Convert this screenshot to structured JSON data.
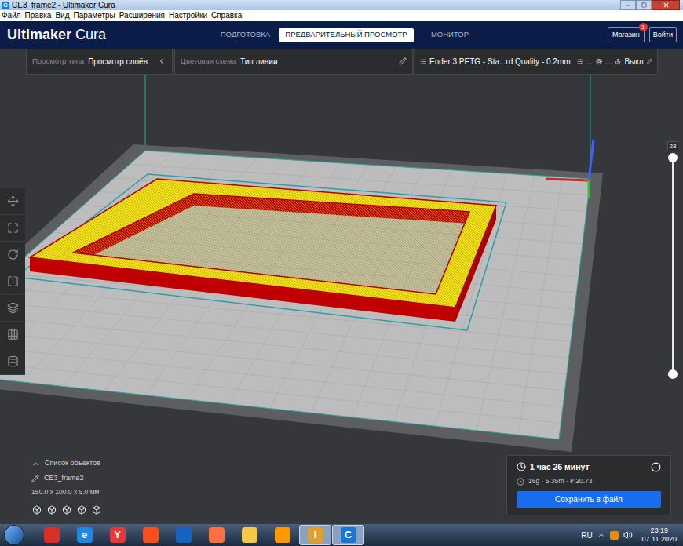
{
  "window": {
    "title": "CE3_frame2 - Ultimaker Cura",
    "app_letter": "C"
  },
  "menu": [
    "Файл",
    "Правка",
    "Вид",
    "Параметры",
    "Расширения",
    "Настройки",
    "Справка"
  ],
  "header": {
    "logo_bold": "Ultimaker",
    "logo_light": "Cura",
    "tabs": [
      {
        "label": "ПОДГОТОВКА",
        "selected": false
      },
      {
        "label": "ПРЕДВАРИТЕЛЬНЫЙ ПРОСМОТР",
        "selected": true
      },
      {
        "label": "МОНИТОР",
        "selected": false
      }
    ],
    "marketplace": {
      "label": "Магазин",
      "badge": "1"
    },
    "login": "Войти"
  },
  "view_bar": {
    "view_type_label": "Просмотр типа",
    "view_type": "Просмотр слоёв",
    "color_scheme_label": "Цветовая схема",
    "color_scheme": "Тип линии",
    "profile": "Ender 3 PETG - Sta...rd Quality - 0.2mm",
    "infill": "...",
    "support": "...",
    "adhesion": "Выкл"
  },
  "layer_slider": {
    "value": "23",
    "level": 1
  },
  "objects": {
    "title": "Список объектов",
    "expanded": false,
    "items": [
      {
        "name": "CE3_frame2"
      }
    ],
    "dimensions": "150.0 x 100.0 x 5.0 мм"
  },
  "print_info": {
    "time": "1 час 26 минут",
    "material": "16g · 5.35m · ₽ 20.73",
    "save_button": "Сохранить в файл"
  },
  "taskbar": {
    "apps": [
      {
        "glyph": "",
        "color": "#d93025",
        "open": false
      },
      {
        "glyph": "e",
        "color": "#1e88e5",
        "open": false
      },
      {
        "glyph": "Y",
        "color": "#e53935",
        "open": false
      },
      {
        "glyph": "",
        "color": "#f4511e",
        "open": false
      },
      {
        "glyph": "",
        "color": "#1565c0",
        "open": false
      },
      {
        "glyph": "",
        "color": "#ff7043",
        "open": false
      },
      {
        "glyph": "",
        "color": "#f2c94c",
        "open": false
      },
      {
        "glyph": "",
        "color": "#ff9800",
        "open": false
      },
      {
        "glyph": "I",
        "color": "#e0a030",
        "open": true
      },
      {
        "glyph": "C",
        "color": "#1976d2",
        "open": true
      }
    ],
    "language": "RU",
    "time": "23:19",
    "date": "07.11.2020"
  }
}
